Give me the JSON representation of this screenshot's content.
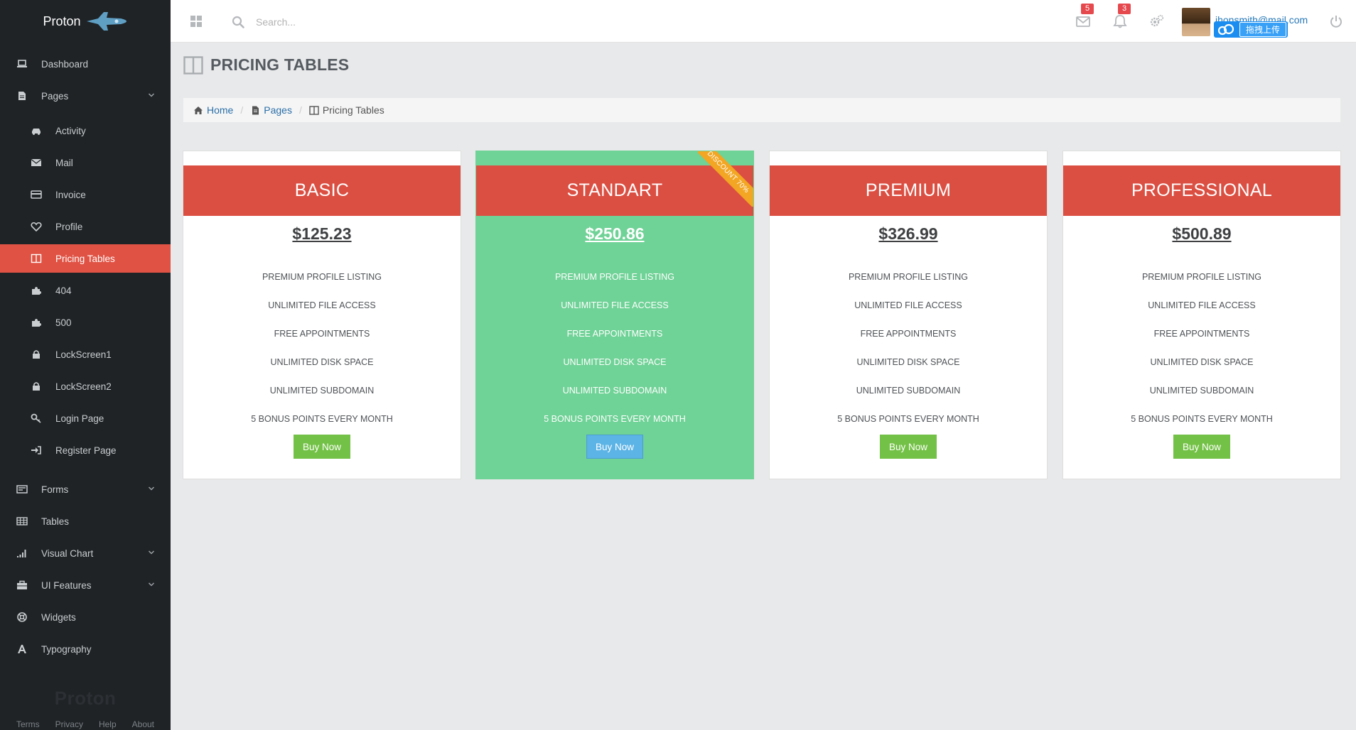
{
  "sidebar": {
    "brand": "Proton",
    "items": [
      {
        "label": "Dashboard",
        "icon": "laptop-icon",
        "level": "top"
      },
      {
        "label": "Pages",
        "icon": "file-icon",
        "level": "top",
        "caret": true
      },
      {
        "label": "Activity",
        "icon": "car-icon",
        "level": "sub"
      },
      {
        "label": "Mail",
        "icon": "envelope-icon",
        "level": "sub"
      },
      {
        "label": "Invoice",
        "icon": "credit-card-icon",
        "level": "sub"
      },
      {
        "label": "Profile",
        "icon": "heart-icon",
        "level": "sub"
      },
      {
        "label": "Pricing Tables",
        "icon": "columns-icon",
        "level": "sub",
        "active": true
      },
      {
        "label": "404",
        "icon": "puzzle-icon",
        "level": "sub"
      },
      {
        "label": "500",
        "icon": "puzzle-icon",
        "level": "sub"
      },
      {
        "label": "LockScreen1",
        "icon": "lock-icon",
        "level": "sub"
      },
      {
        "label": "LockScreen2",
        "icon": "lock-icon",
        "level": "sub"
      },
      {
        "label": "Login Page",
        "icon": "key-icon",
        "level": "sub"
      },
      {
        "label": "Register Page",
        "icon": "sign-in-icon",
        "level": "sub"
      },
      {
        "label": "Forms",
        "icon": "form-icon",
        "level": "top",
        "caret": true
      },
      {
        "label": "Tables",
        "icon": "table-icon",
        "level": "top"
      },
      {
        "label": "Visual Chart",
        "icon": "signal-icon",
        "level": "top",
        "caret": true
      },
      {
        "label": "UI Features",
        "icon": "briefcase-icon",
        "level": "top",
        "caret": true
      },
      {
        "label": "Widgets",
        "icon": "lifebuoy-icon",
        "level": "top"
      },
      {
        "label": "Typography",
        "icon": "font-icon",
        "level": "top"
      }
    ],
    "footer_logo": "Proton",
    "footer_links": [
      "Terms",
      "Privacy",
      "Help",
      "About"
    ]
  },
  "topbar": {
    "search_placeholder": "Search...",
    "mail_badge": "5",
    "notification_badge": "3",
    "user_email": "jhonsmith@mail.com",
    "upload_label": "拖拽上传"
  },
  "page": {
    "title": "PRICING TABLES",
    "breadcrumb": [
      {
        "label": "Home",
        "icon": "home-icon"
      },
      {
        "label": "Pages",
        "icon": "file-icon"
      },
      {
        "label": "Pricing Tables",
        "icon": "columns-icon"
      }
    ]
  },
  "pricing": [
    {
      "name": "BASIC",
      "price": "$125.23",
      "featured": false,
      "features": [
        "PREMIUM PROFILE LISTING",
        "UNLIMITED FILE ACCESS",
        "FREE APPOINTMENTS",
        "UNLIMITED DISK SPACE",
        "UNLIMITED SUBDOMAIN",
        "5 BONUS POINTS EVERY MONTH"
      ],
      "button": "Buy Now"
    },
    {
      "name": "STANDART",
      "price": "$250.86",
      "featured": true,
      "ribbon": "DISCOUNT 70%",
      "features": [
        "PREMIUM PROFILE LISTING",
        "UNLIMITED FILE ACCESS",
        "FREE APPOINTMENTS",
        "UNLIMITED DISK SPACE",
        "UNLIMITED SUBDOMAIN",
        "5 BONUS POINTS EVERY MONTH"
      ],
      "button": "Buy Now"
    },
    {
      "name": "PREMIUM",
      "price": "$326.99",
      "featured": false,
      "features": [
        "PREMIUM PROFILE LISTING",
        "UNLIMITED FILE ACCESS",
        "FREE APPOINTMENTS",
        "UNLIMITED DISK SPACE",
        "UNLIMITED SUBDOMAIN",
        "5 BONUS POINTS EVERY MONTH"
      ],
      "button": "Buy Now"
    },
    {
      "name": "PROFESSIONAL",
      "price": "$500.89",
      "featured": false,
      "features": [
        "PREMIUM PROFILE LISTING",
        "UNLIMITED FILE ACCESS",
        "FREE APPOINTMENTS",
        "UNLIMITED DISK SPACE",
        "UNLIMITED SUBDOMAIN",
        "5 BONUS POINTS EVERY MONTH"
      ],
      "button": "Buy Now"
    }
  ],
  "colors": {
    "sidebar_bg": "#1f2326",
    "accent_red": "#db4f42",
    "featured_green": "#6fd296",
    "buy_green": "#73c146",
    "buy_blue": "#5bb3e6",
    "ribbon_orange": "#f2a623",
    "badge_red": "#e5484d"
  }
}
